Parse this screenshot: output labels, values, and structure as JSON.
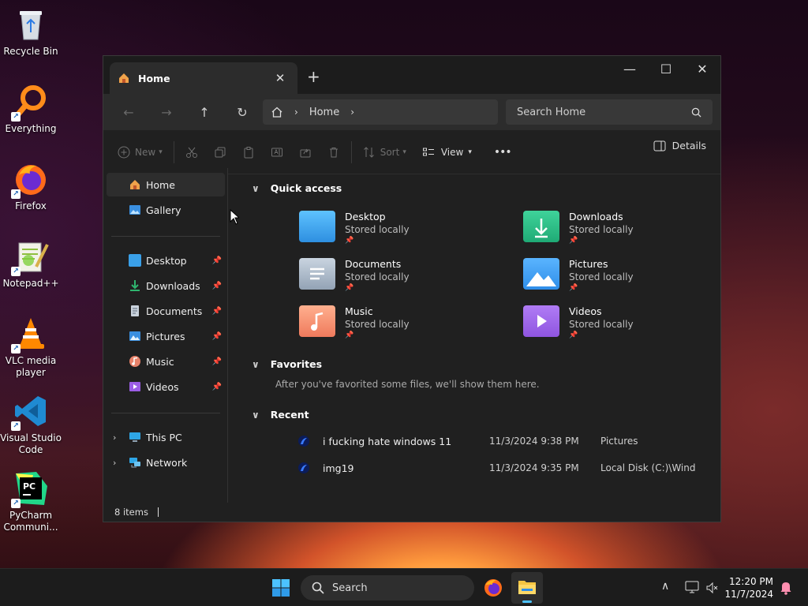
{
  "desktop_icons": [
    {
      "label": "Recycle Bin",
      "icon": "recycle-bin-icon"
    },
    {
      "label": "Everything",
      "icon": "everything-search-icon"
    },
    {
      "label": "Firefox",
      "icon": "firefox-icon"
    },
    {
      "label": "Notepad++",
      "icon": "notepad-plus-plus-icon"
    },
    {
      "label": "VLC media player",
      "icon": "vlc-icon"
    },
    {
      "label": "Visual Studio Code",
      "icon": "vscode-icon"
    },
    {
      "label": "PyCharm Communi...",
      "icon": "pycharm-icon"
    }
  ],
  "window": {
    "tab_title": "Home",
    "close_tab": "✕",
    "new_tab": "+",
    "controls": {
      "minimize": "—",
      "maximize": "☐",
      "close": "✕"
    }
  },
  "nav": {
    "back": "←",
    "forward": "→",
    "up": "↑",
    "refresh": "↻",
    "breadcrumb": "Home",
    "search_placeholder": "Search Home"
  },
  "toolbar": {
    "new_label": "New",
    "sort_label": "Sort",
    "view_label": "View",
    "more_label": "•••",
    "details_label": "Details"
  },
  "sidebar": {
    "top": [
      {
        "label": "Home",
        "selected": true
      },
      {
        "label": "Gallery"
      }
    ],
    "pinned": [
      {
        "label": "Desktop",
        "color": "#3aa0e8"
      },
      {
        "label": "Downloads",
        "color": "#2fb46e"
      },
      {
        "label": "Documents",
        "color": "#b9c3cf"
      },
      {
        "label": "Pictures",
        "color": "#3a8fe0"
      },
      {
        "label": "Music",
        "color": "#e8826a"
      },
      {
        "label": "Videos",
        "color": "#9b5de5"
      }
    ],
    "bottom": [
      {
        "label": "This PC"
      },
      {
        "label": "Network"
      }
    ]
  },
  "quick_access": {
    "header": "Quick access",
    "items": [
      {
        "name": "Desktop",
        "sub": "Stored locally",
        "color": "#2e8fe0"
      },
      {
        "name": "Downloads",
        "sub": "Stored locally",
        "color": "#1faa75"
      },
      {
        "name": "Documents",
        "sub": "Stored locally",
        "color": "#a9b6c6"
      },
      {
        "name": "Pictures",
        "sub": "Stored locally",
        "color": "#2f8ee8"
      },
      {
        "name": "Music",
        "sub": "Stored locally",
        "color": "#ef8a6c"
      },
      {
        "name": "Videos",
        "sub": "Stored locally",
        "color": "#8f55e0"
      }
    ]
  },
  "favorites": {
    "header": "Favorites",
    "note": "After you've favorited some files, we'll show them here."
  },
  "recent": {
    "header": "Recent",
    "rows": [
      {
        "name": "i fucking hate windows 11",
        "date": "11/3/2024 9:38 PM",
        "location": "Pictures"
      },
      {
        "name": "img19",
        "date": "11/3/2024 9:35 PM",
        "location": "Local Disk (C:)\\Wind..."
      }
    ]
  },
  "status": {
    "items": "8 items"
  },
  "taskbar": {
    "search_label": "Search",
    "time": "12:20 PM",
    "date": "11/7/2024"
  }
}
